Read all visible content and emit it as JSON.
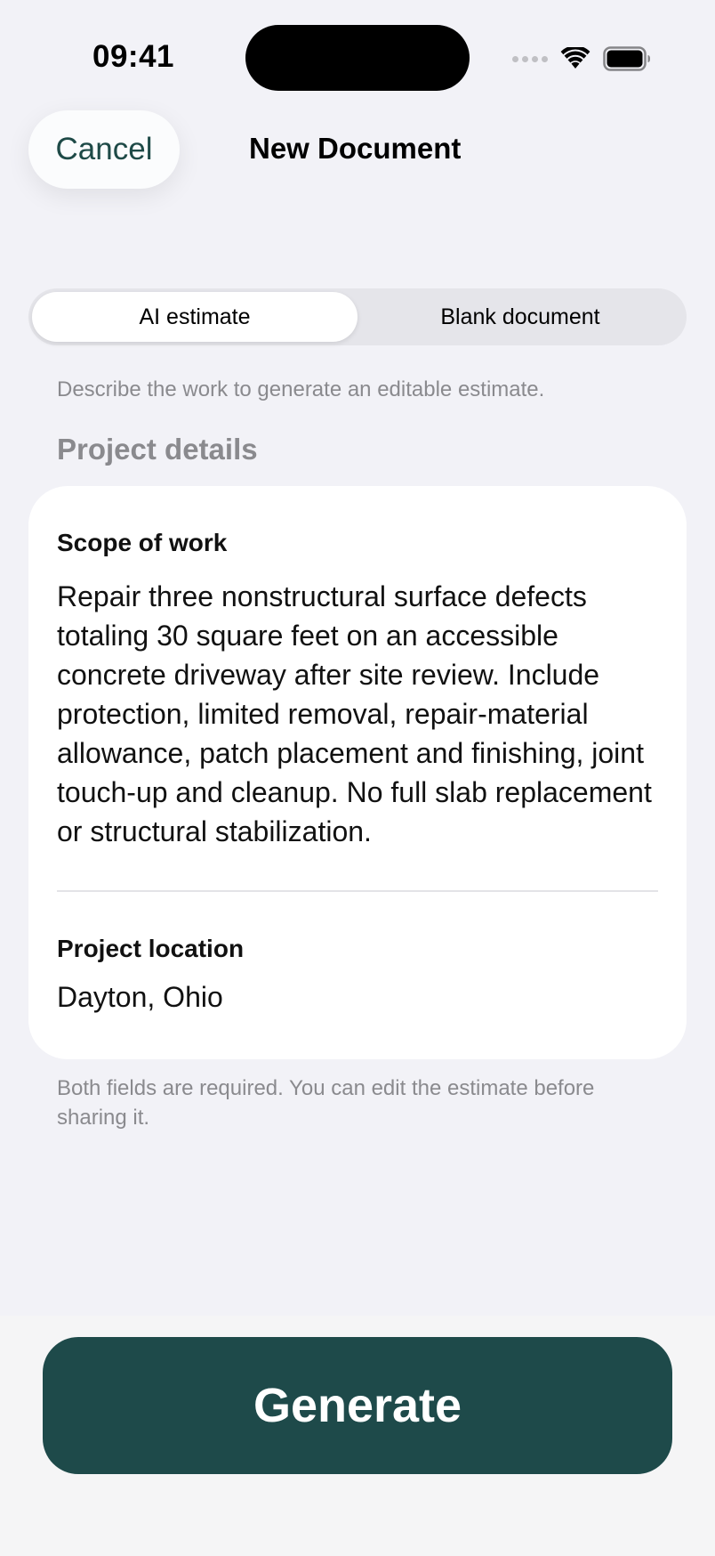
{
  "status_bar": {
    "time": "09:41"
  },
  "nav": {
    "cancel_label": "Cancel",
    "title": "New Document"
  },
  "segments": {
    "ai_estimate": "AI estimate",
    "blank_document": "Blank document",
    "selected": "AI estimate"
  },
  "helper_text": "Describe the work to generate an editable estimate.",
  "section_header": "Project details",
  "form": {
    "scope_label": "Scope of work",
    "scope_value": "Repair three nonstructural surface defects totaling 30 square feet on an accessible concrete driveway after site review. Include protection, limited removal, repair-material allowance, patch placement and finishing, joint touch-up and cleanup. No full slab replacement or structural stabilization.",
    "location_label": "Project location",
    "location_value": "Dayton, Ohio"
  },
  "footnote": "Both fields are required. You can edit the estimate before sharing it.",
  "generate_label": "Generate",
  "colors": {
    "accent": "#1e4a4a",
    "background": "#f2f2f7",
    "secondary_text": "#8a8a8e"
  },
  "icons": [
    "cellular-signal-icon",
    "wifi-icon",
    "battery-icon"
  ]
}
